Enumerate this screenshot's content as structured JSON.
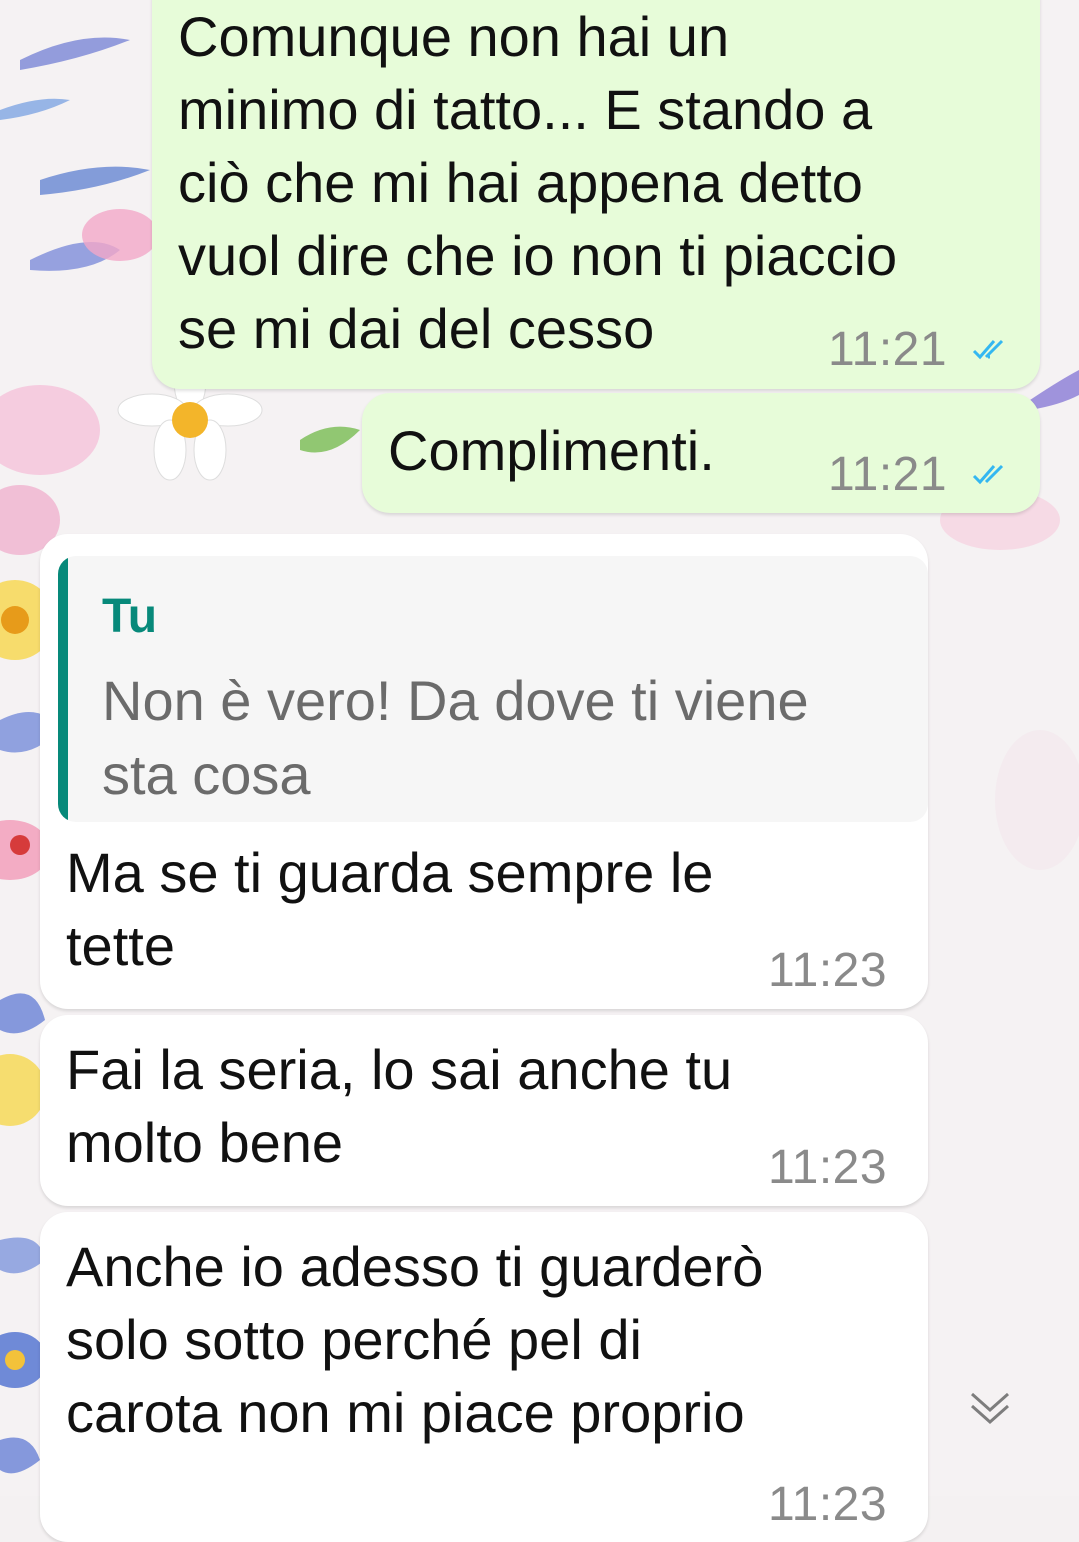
{
  "messages": [
    {
      "direction": "outgoing",
      "text": "Comunque non hai un\nminimo di tatto... E stando a\nciò che mi hai appena detto\nvuol dire che io non ti piaccio\nse mi dai del cesso",
      "time": "11:21",
      "status": "read"
    },
    {
      "direction": "outgoing",
      "text": "Complimenti.",
      "time": "11:21",
      "status": "read"
    },
    {
      "direction": "incoming",
      "quote": {
        "author": "Tu",
        "text": "Non è vero! Da dove ti viene\nsta cosa"
      },
      "text": "Ma se ti guarda sempre le\ntette",
      "time": "11:23"
    },
    {
      "direction": "incoming",
      "text": "Fai la seria, lo sai anche tu\nmolto bene",
      "time": "11:23"
    },
    {
      "direction": "incoming",
      "text": "Anche io adesso ti guarderò\nsolo sotto perché pel di\ncarota non mi piace proprio",
      "time": "11:23"
    }
  ],
  "icons": {
    "read_receipt": "double-check-icon",
    "scroll_down": "chevron-double-down-icon"
  },
  "colors": {
    "outgoing_bubble": "#e7fcd9",
    "incoming_bubble": "#ffffff",
    "read_ticks": "#34b7f1",
    "quote_accent": "#07897a",
    "timestamp": "#8a8a8a"
  }
}
